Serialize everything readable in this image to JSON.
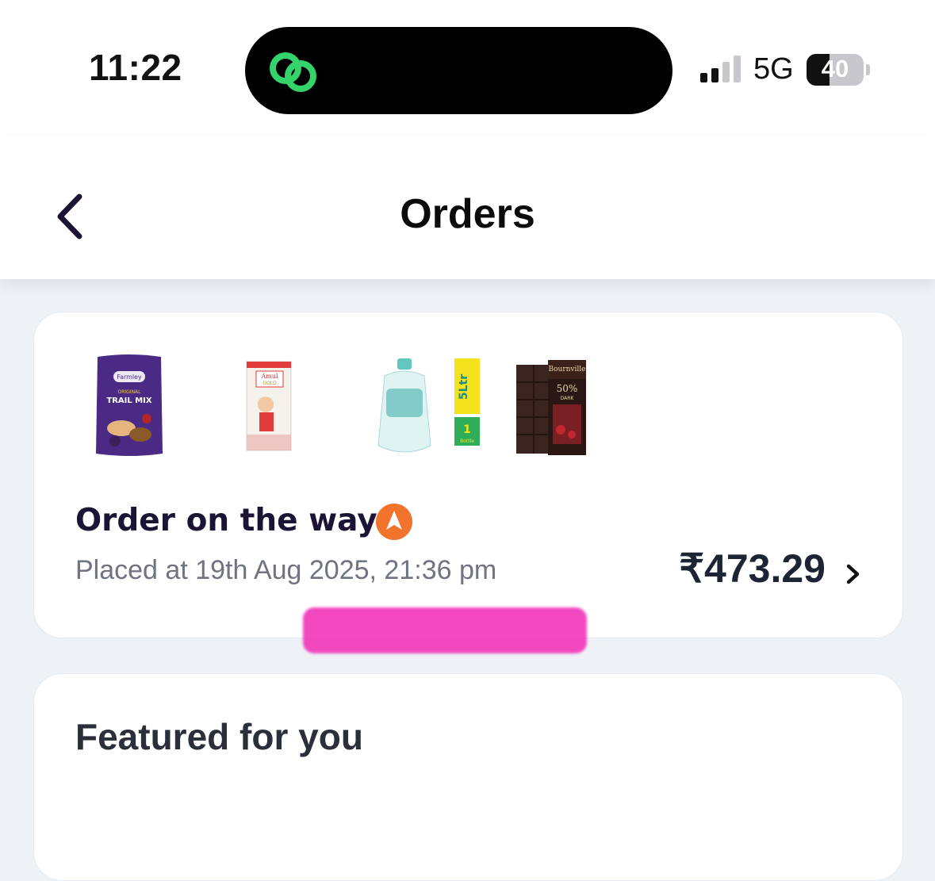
{
  "status_bar": {
    "time": "11:22",
    "network": "5G",
    "battery_level": "40",
    "battery_fraction": 0.4,
    "signal_bars_active": 2,
    "signal_bars_total": 4
  },
  "header": {
    "title": "Orders",
    "back_icon": "chevron-left-icon"
  },
  "order": {
    "items": [
      {
        "name": "Farmley Original Trail Mix",
        "pack_brand": "Farmley",
        "pack_text": "ORIGINAL",
        "pack_title": "TRAIL MIX"
      },
      {
        "name": "Amul Gold Milk",
        "pack_brand": "Amul",
        "pack_text": "GOLD"
      },
      {
        "name": "5 Ltr Water Bottle",
        "pack_text": "5Ltr",
        "pack_count": "1",
        "pack_unit": "Bottle"
      },
      {
        "name": "Cadbury Bournville Dark",
        "pack_brand": "Bournville",
        "pack_text": "50%",
        "pack_sub": "DARK"
      }
    ],
    "status": "Order on the way",
    "status_icon": "navigation-arrow-icon",
    "placed_at": "Placed at 19th Aug 2025, 21:36 pm",
    "total": "₹473.29",
    "chevron_icon": "chevron-right-icon"
  },
  "featured": {
    "title": "Featured for you"
  },
  "colors": {
    "background": "#eef1f6",
    "status_title": "#1c1335",
    "accent_orange": "#f1732c",
    "island_icon_green": "#35d36b",
    "highlight_pink": "#f23fbd"
  }
}
